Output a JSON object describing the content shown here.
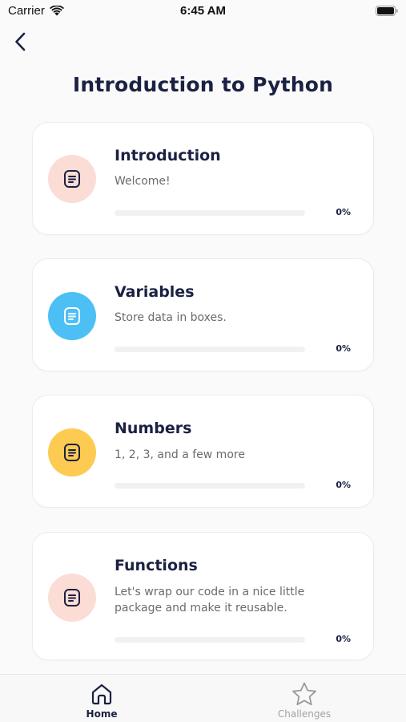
{
  "status_bar": {
    "carrier": "Carrier",
    "time": "6:45 AM"
  },
  "header": {
    "back_icon": "chevron-left-icon",
    "title": "Introduction to Python"
  },
  "lessons": [
    {
      "title": "Introduction",
      "description": "Welcome!",
      "progress_label": "0%",
      "progress": 0,
      "icon": "document-icon",
      "icon_bg": "#fbddd6"
    },
    {
      "title": "Variables",
      "description": "Store data in boxes.",
      "progress_label": "0%",
      "progress": 0,
      "icon": "document-icon",
      "icon_bg": "#4cc0f5"
    },
    {
      "title": "Numbers",
      "description": "1, 2, 3, and a few more",
      "progress_label": "0%",
      "progress": 0,
      "icon": "document-icon",
      "icon_bg": "#fdcb52"
    },
    {
      "title": "Functions",
      "description": "Let's wrap our code in a nice little package and make it reusable.",
      "progress_label": "0%",
      "progress": 0,
      "icon": "document-icon",
      "icon_bg": "#fbddd6"
    }
  ],
  "tab_bar": {
    "home": {
      "label": "Home",
      "icon": "home-icon"
    },
    "challenges": {
      "label": "Challenges",
      "icon": "star-icon"
    }
  },
  "colors": {
    "title": "#1b2142",
    "progress_track": "#f1f1f1",
    "inactive_tab": "#a2a2a2"
  }
}
